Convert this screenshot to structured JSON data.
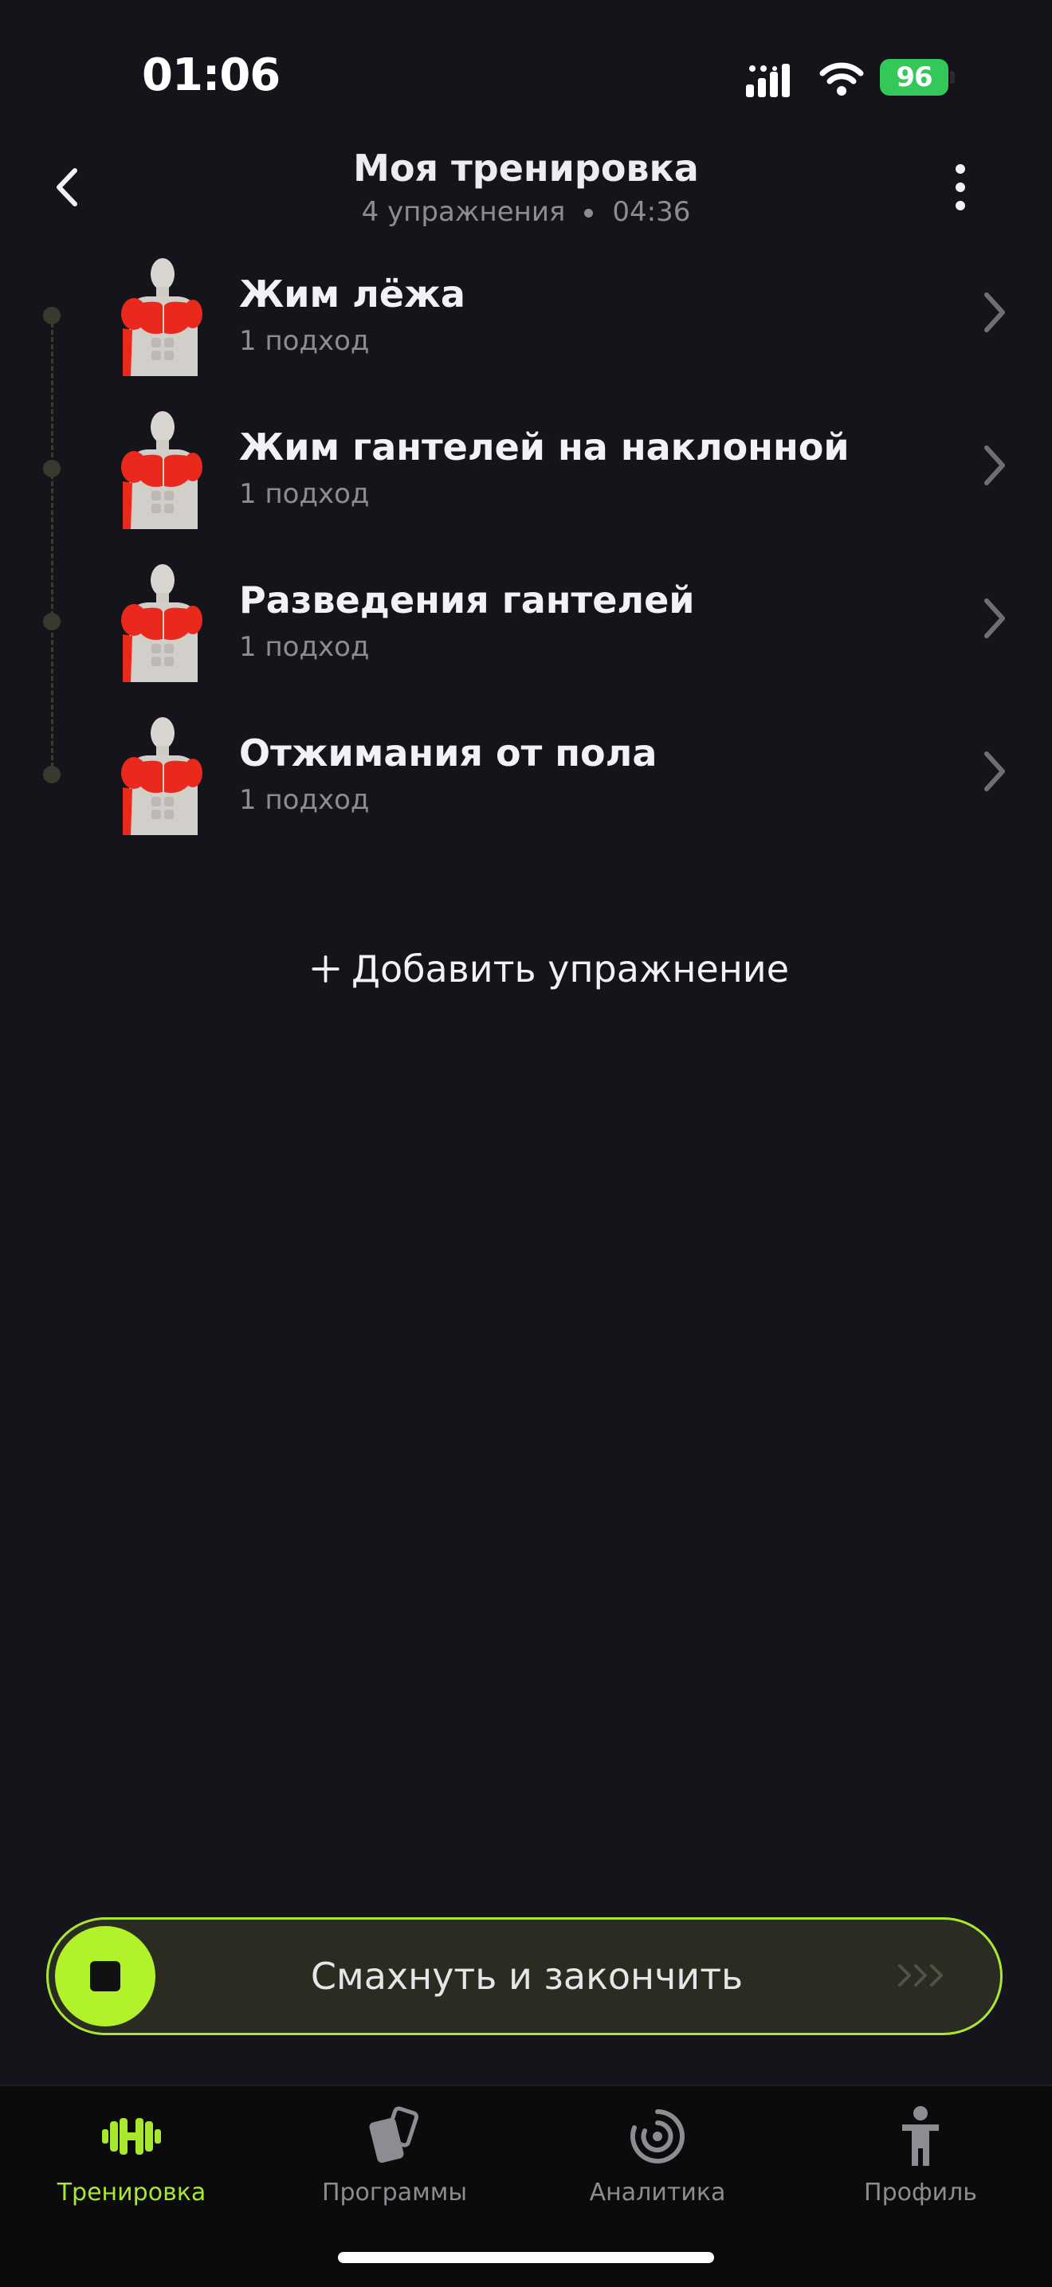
{
  "status_bar": {
    "time": "01:06",
    "battery": "96"
  },
  "header": {
    "title": "Моя тренировка",
    "exercise_count": "4 упражнения",
    "duration": "04:36"
  },
  "exercises": [
    {
      "name": "Жим лёжа",
      "sets": "1 подход"
    },
    {
      "name": "Жим гантелей на наклонной",
      "sets": "1 подход"
    },
    {
      "name": "Разведения гантелей",
      "sets": "1 подход"
    },
    {
      "name": "Отжимания от пола",
      "sets": "1 подход"
    }
  ],
  "add_exercise_label": "Добавить упражнение",
  "swipe_label": "Смахнуть и закончить",
  "tabs": [
    {
      "label": "Тренировка",
      "icon": "dumbbell-icon",
      "active": true
    },
    {
      "label": "Программы",
      "icon": "cards-icon",
      "active": false
    },
    {
      "label": "Аналитика",
      "icon": "target-icon",
      "active": false
    },
    {
      "label": "Профиль",
      "icon": "person-icon",
      "active": false
    }
  ],
  "colors": {
    "background": "#16141b",
    "accent": "#a8e82e",
    "muscle": "#e8291c",
    "battery": "#34c759"
  }
}
